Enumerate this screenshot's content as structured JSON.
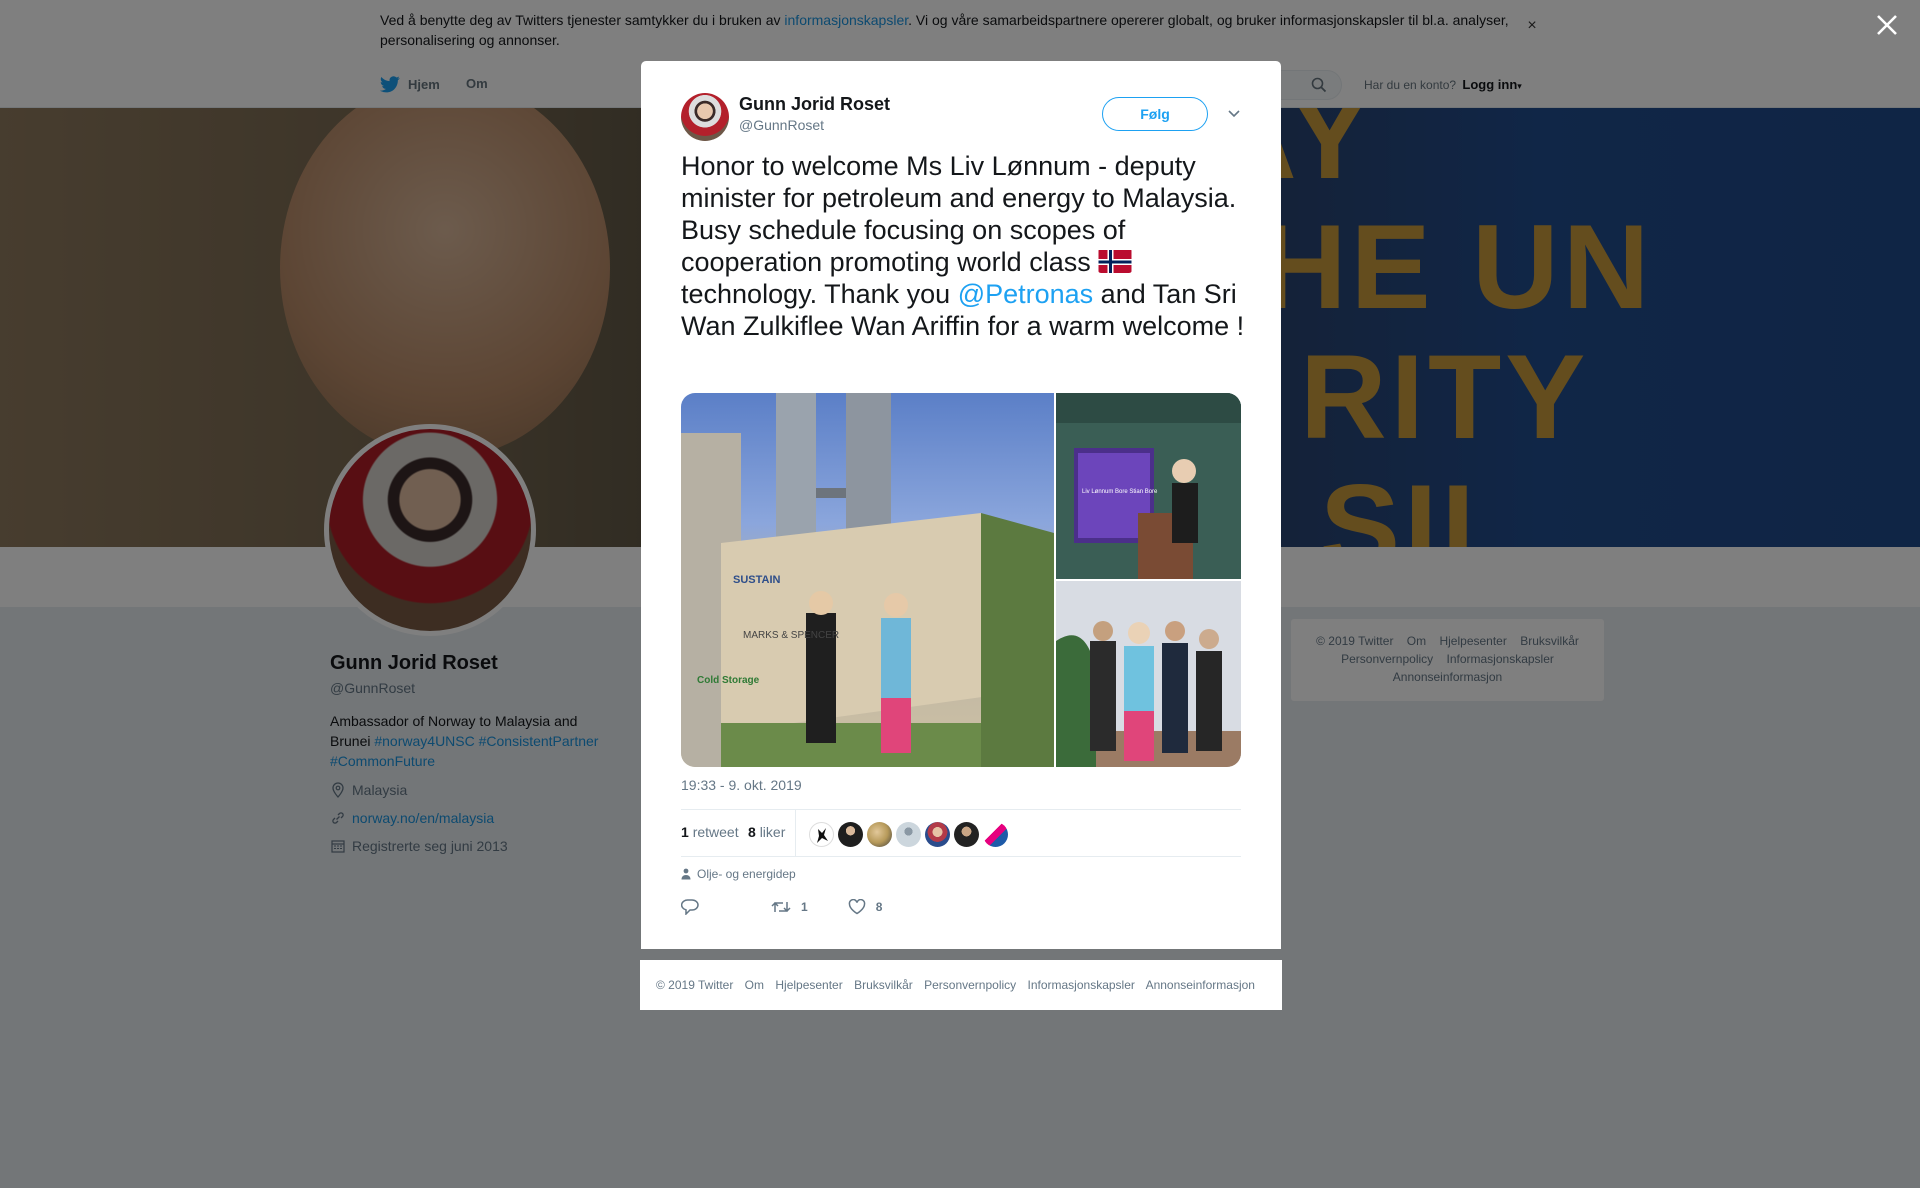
{
  "cookie_banner": {
    "text_before": "Ved å benytte deg av Twitters tjenester samtykker du i bruken av ",
    "link": "informasjonskapsler",
    "text_after": ". Vi og våre samarbeidspartnere opererer globalt, og bruker informasjonskapsler til bl.a. analyser, personalisering og annonser.",
    "close": "×"
  },
  "nav": {
    "home": "Hjem",
    "about": "Om",
    "login_prompt": "Har du en konto?",
    "login": "Logg inn"
  },
  "banner": {
    "line1": "AY",
    "line2": "HE UN",
    "line3": "RITY",
    "line4": "SIL"
  },
  "profile": {
    "name": "Gunn Jorid Roset",
    "handle": "@GunnRoset",
    "bio_text": "Ambassador of Norway to Malaysia and Brunei ",
    "hashtags": [
      "#norway4UNSC",
      "#ConsistentPartner",
      "#CommonFuture"
    ],
    "location": "Malaysia",
    "website": "norway.no/en/malaysia",
    "joined": "Registrerte seg juni 2013"
  },
  "side_footer": {
    "items": [
      "© 2019 Twitter",
      "Om",
      "Hjelpesenter",
      "Bruksvilkår",
      "Personvernpolicy",
      "Informasjonskapsler",
      "Annonseinformasjon"
    ]
  },
  "tweet": {
    "author_name": "Gunn Jorid Roset",
    "author_handle": "@GunnRoset",
    "follow_label": "Følg",
    "text_part1": "Honor to welcome Ms Liv Lønnum - deputy minister for petroleum and energy to Malaysia. Busy schedule focusing on scopes of cooperation promoting world class ",
    "text_part2": " technology. Thank you ",
    "mention": "@Petronas",
    "text_part3": " and Tan Sri Wan Zulkiflee Wan Ariffin for a warm welcome !",
    "timestamp": "19:33 - 9. okt. 2019",
    "retweets": "1",
    "retweet_label": "retweet",
    "likes": "8",
    "like_label": "liker",
    "context": "Olje- og energidep",
    "reply_count": "",
    "retweet_count": "1",
    "like_count": "8",
    "photo_signs": {
      "sign1": "SUSTAIN",
      "sign2": "MARKS & SPENCER",
      "sign3": "Cold Storage",
      "slide": "Liv Lønnum Bore Stian Bore"
    }
  },
  "modal_footer": {
    "items": [
      "© 2019 Twitter",
      "Om",
      "Hjelpesenter",
      "Bruksvilkår",
      "Personvernpolicy",
      "Informasjonskapsler",
      "Annonseinformasjon"
    ]
  },
  "colors": {
    "link_blue": "#1b95e0",
    "twitter_blue": "#1da1f2",
    "text_dark": "#14171a",
    "text_muted": "#657786",
    "overlay": "rgba(0,0,0,0.5)"
  },
  "icons": {
    "close": "close-icon",
    "twitter": "twitter-bird-icon",
    "search": "search-icon",
    "caret": "chevron-down-icon",
    "location": "location-pin-icon",
    "link": "link-icon",
    "calendar": "calendar-icon",
    "reply": "reply-icon",
    "retweet": "retweet-icon",
    "like": "heart-icon",
    "person": "person-icon"
  }
}
